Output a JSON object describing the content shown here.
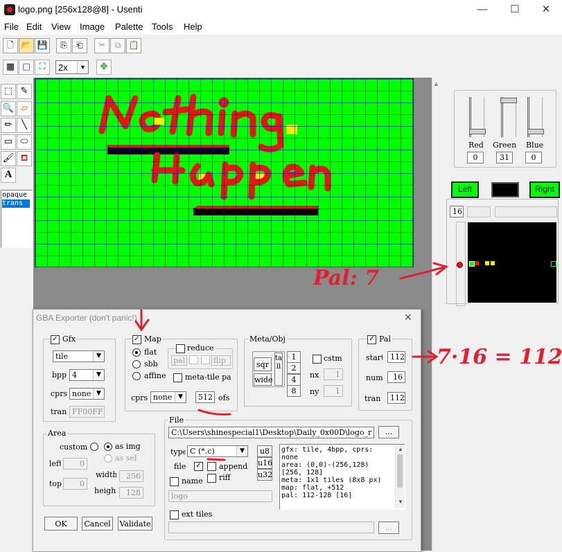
{
  "window": {
    "title": "logo.png [256x128@8] - Usenti",
    "minimize": "—",
    "maximize": "☐",
    "close": "✕"
  },
  "menu": [
    "File",
    "Edit",
    "View",
    "Image",
    "Palette",
    "Tools",
    "Help"
  ],
  "toolbar": {
    "zoom_value": "2x"
  },
  "tools_list": {
    "items": [
      "opaque",
      "trans"
    ],
    "selected": "trans"
  },
  "canvas": {
    "background_color": "#00ff00",
    "grid_color": "#0000c0",
    "paint_color": "#e01818",
    "highlight_color": "#f0f000",
    "shadow_color": "#000000"
  },
  "color_sliders": {
    "labels": [
      "Red",
      "Green",
      "Blue"
    ],
    "values": [
      "0",
      "31",
      "0"
    ]
  },
  "palette_panel": {
    "left_label": "Left",
    "right_label": "Right",
    "index_value": "16"
  },
  "dialog": {
    "title": "GBA Exporter (don't panic!)",
    "gfx": {
      "label": "Gfx",
      "type": "tile",
      "bpp_label": "bpp",
      "bpp": "4",
      "cprs_label": "cprs",
      "cprs": "none",
      "tran_label": "tran",
      "tran": "FF00FF"
    },
    "map": {
      "label": "Map",
      "opt_flat": "flat",
      "opt_sbb": "sbb",
      "opt_affine": "affine",
      "reduce_label": "reduce",
      "reduce_pal": "pal",
      "reduce_flip": "flip",
      "metatile_label": "meta-tile pal",
      "cprs_label": "cprs",
      "cprs": "none",
      "ofs_value": "512",
      "ofs_label": "ofs"
    },
    "metaobj": {
      "label": "Meta/Obj",
      "sqr": "sqr",
      "wide": "wide",
      "tall": "tall",
      "nums": [
        "1",
        "2",
        "4",
        "8"
      ],
      "cstm_label": "cstm",
      "nx_label": "nx",
      "nx": "1",
      "ny_label": "ny",
      "ny": "1"
    },
    "pal": {
      "label": "Pal",
      "start_label": "start",
      "start": "112",
      "num_label": "num",
      "num": "16",
      "tran_label": "tran",
      "tran": "112"
    },
    "area": {
      "label": "Area",
      "custom": "custom",
      "as_img": "as img",
      "as_sel": "as sel",
      "left_label": "left",
      "left": "0",
      "top_label": "top",
      "top": "0",
      "width_label": "width",
      "width": "256",
      "height_label": "height",
      "height": "128"
    },
    "file": {
      "label": "File",
      "path": "C:\\Users\\shinespecial1\\Desktop\\Daily_0x00D\\logo_r",
      "browse": "...",
      "type_label": "type",
      "type": "C (*.c)",
      "u8": "u8",
      "u16": "u16",
      "u32": "u32",
      "file_label": "file",
      "append_label": "append",
      "name_label": "name",
      "riff_label": "riff",
      "name_value": "logo",
      "ext_tiles_label": "ext tiles",
      "info_lines": [
        "gfx: tile, 4bpp, cprs:",
        "none",
        "area: (0,0)-(256,128)",
        "[256, 128]",
        "meta: 1x1 tiles (8x8 px)",
        "map: flat, +512",
        "pal: 112-128 [16]"
      ]
    },
    "buttons": {
      "ok": "OK",
      "cancel": "Cancel",
      "validate": "Validate"
    }
  },
  "annotations": {
    "pal": "Pal: 7",
    "formula": "7·16 = 112"
  }
}
